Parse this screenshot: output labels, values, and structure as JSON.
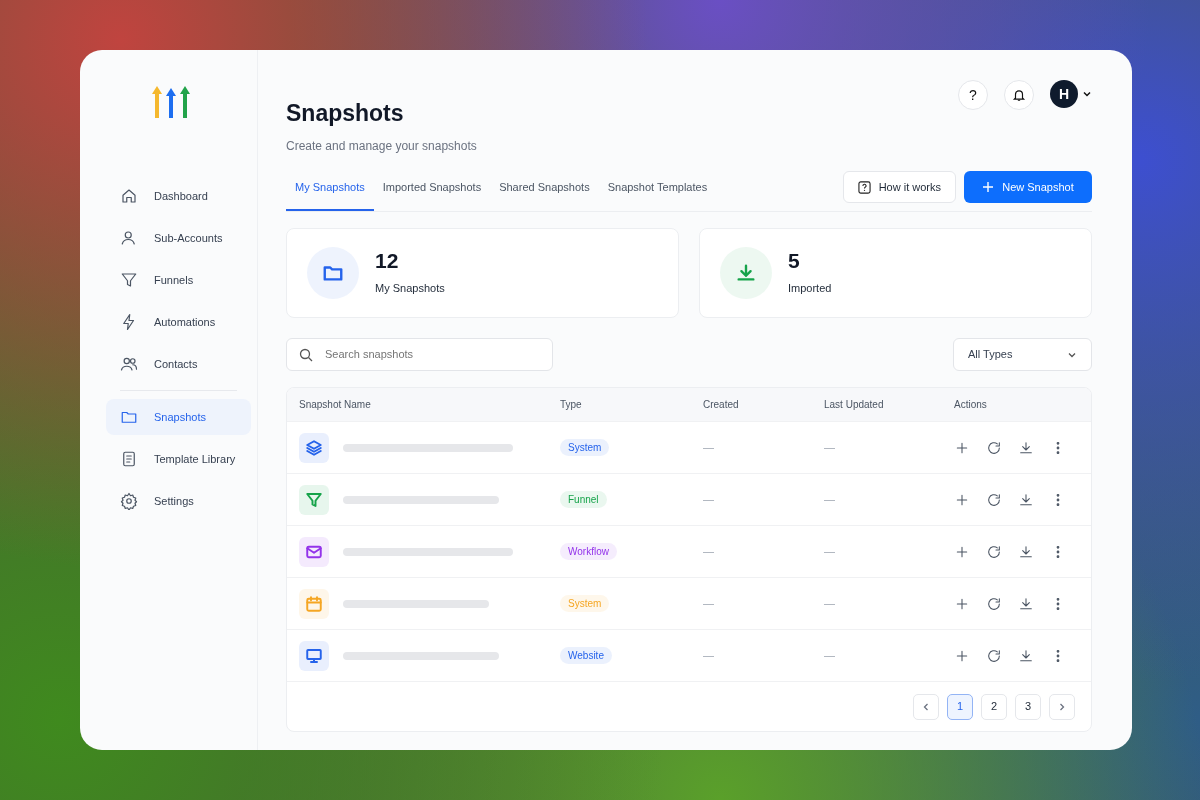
{
  "sidebar": {
    "items": [
      {
        "label": "Dashboard",
        "selected": false
      },
      {
        "label": "Sub-Accounts",
        "selected": false
      },
      {
        "label": "Funnels",
        "selected": false
      },
      {
        "label": "Automations",
        "selected": false
      },
      {
        "label": "Contacts",
        "selected": false
      },
      {
        "label": "Snapshots",
        "selected": true
      },
      {
        "label": "Template Library",
        "selected": false
      },
      {
        "label": "Settings",
        "selected": false
      }
    ]
  },
  "header": {
    "title": "Snapshots",
    "subtitle": "Create and manage your snapshots",
    "help": "?",
    "avatar": "H"
  },
  "tabs": [
    {
      "label": "My Snapshots",
      "selected": true
    },
    {
      "label": "Imported Snapshots",
      "selected": false
    },
    {
      "label": "Shared Snapshots",
      "selected": false
    },
    {
      "label": "Snapshot Templates",
      "selected": false
    }
  ],
  "buttons": {
    "how": "How it works",
    "new": "New Snapshot"
  },
  "stats": [
    {
      "value": "12",
      "label": "My Snapshots",
      "color": "#2563eb"
    },
    {
      "value": "5",
      "label": "Imported",
      "color": "#16a34a"
    }
  ],
  "search": {
    "placeholder": "Search snapshots"
  },
  "filter": {
    "value": "All Types"
  },
  "table": {
    "columns": [
      "Snapshot Name",
      "Type",
      "Created",
      "Last Updated",
      "Actions"
    ],
    "rows": [
      {
        "color": "#2563eb",
        "type": "System",
        "created": "—",
        "updated": "—"
      },
      {
        "color": "#16a34a",
        "type": "Funnel",
        "created": "—",
        "updated": "—"
      },
      {
        "color": "#9333ea",
        "type": "Workflow",
        "created": "—",
        "updated": "—"
      },
      {
        "color": "#f5a623",
        "type": "System",
        "created": "—",
        "updated": "—"
      },
      {
        "color": "#2563eb",
        "type": "Website",
        "created": "—",
        "updated": "—"
      }
    ]
  },
  "pagination": {
    "pages": [
      {
        "label": "1",
        "selected": true
      },
      {
        "label": "2",
        "selected": false
      },
      {
        "label": "3",
        "selected": false
      }
    ]
  }
}
